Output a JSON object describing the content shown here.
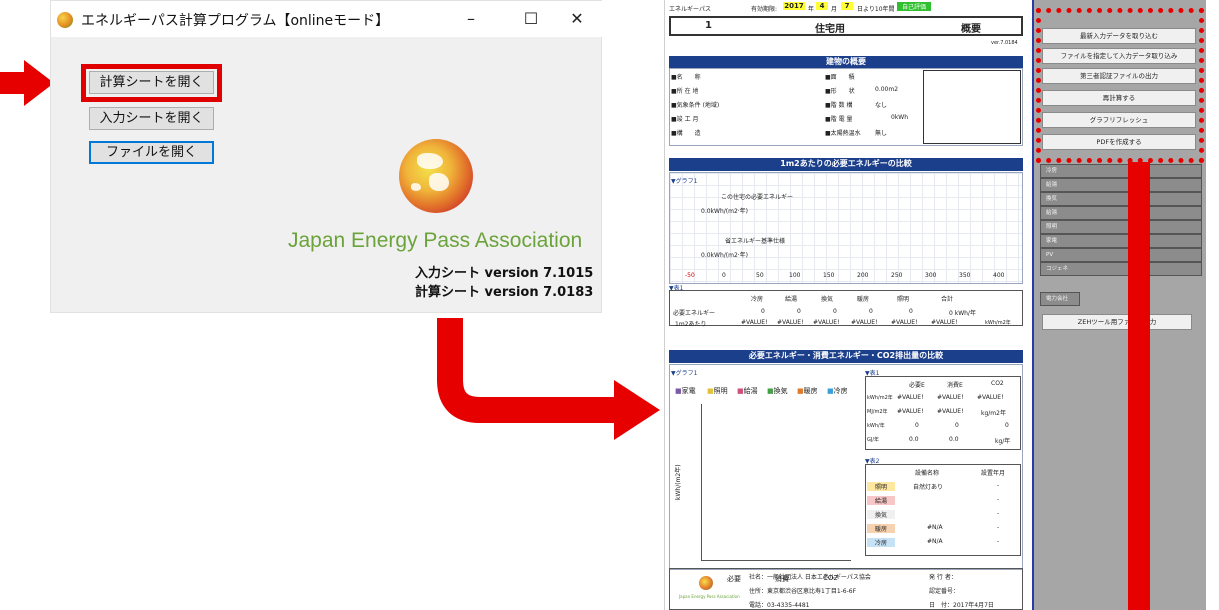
{
  "launcher": {
    "title": "エネルギーパス計算プログラム【onlineモード】",
    "minimize": "–",
    "maximize": "☐",
    "close": "✕",
    "buttons": {
      "open_calc": "計算シートを開く",
      "open_input": "入力シートを開く",
      "open_file": "ファイルを開く"
    },
    "org_name": "Japan Energy Pass Association",
    "input_version": "入力シート version 7.1015",
    "calc_version": "計算シート version 7.0183"
  },
  "sheet": {
    "header": {
      "app": "エネルギーパス",
      "valid_label": "有効期限:",
      "year": "2017",
      "year_unit": "年",
      "month": "4",
      "month_unit": "月",
      "day": "7",
      "period": "日より10年間",
      "self_eval": "自己評価",
      "number": "1",
      "type": "住宅用",
      "summary": "概要",
      "version": "ver.7.0184"
    },
    "overview": {
      "title": "建物の概要",
      "left_labels": [
        "■名　　称",
        "■所 在 地",
        "■気象条件 (地域)",
        "■竣 工 月",
        "■構　　造"
      ],
      "right_labels": [
        "■面　　積",
        "■形　　状",
        "■階 数 構",
        "■階 電 量",
        "■太陽熱温水"
      ],
      "right_values": [
        "",
        "0.00m2",
        "なし",
        "0kWh",
        "無し"
      ]
    },
    "compare": {
      "title": "1m2あたりの必要エネルギーの比較",
      "graph_label": "▼グラフ1",
      "this_house": "この住宅の必要エネルギー",
      "this_val": "0.0kWh/(m2·年)",
      "standard": "省エネルギー基準仕様",
      "standard_val": "0.0kWh/(m2·年)",
      "axis": [
        "-50",
        "0",
        "50",
        "100",
        "150",
        "200",
        "250",
        "300",
        "350",
        "400"
      ],
      "table_label": "▼表1",
      "columns": [
        "冷房",
        "給湯",
        "換気",
        "暖房",
        "照明",
        "合計"
      ],
      "row1_label": "必要エネルギー",
      "row1": [
        "0",
        "0",
        "0",
        "0",
        "0",
        "0 kWh/年"
      ],
      "row2_label": "1m2あたり",
      "row2": [
        "#VALUE!",
        "#VALUE!",
        "#VALUE!",
        "#VALUE!",
        "#VALUE!",
        "#VALUE!"
      ],
      "row2_unit": "kWh/m2年"
    },
    "co2": {
      "title": "必要エネルギー・消費エネルギー・CO2排出量の比較",
      "graph_label": "▼グラフ1",
      "legend": [
        "家電",
        "照明",
        "給湯",
        "換気",
        "暖房",
        "冷房"
      ],
      "y_axis": "kWh/(m2年)",
      "x_labels": [
        "必要",
        "消費",
        "CO2"
      ],
      "table_label": "▼表1",
      "cols": [
        "必要E",
        "消費E",
        "CO2"
      ],
      "rows": [
        {
          "unit": "kWh/m2年",
          "vals": [
            "#VALUE!",
            "#VALUE!",
            "#VALUE!"
          ]
        },
        {
          "unit": "MJ/m2年",
          "vals": [
            "#VALUE!",
            "#VALUE!",
            "kg/m2年"
          ]
        },
        {
          "unit": "kWh/年",
          "vals": [
            "0",
            "0",
            "0"
          ]
        },
        {
          "unit": "GJ/年",
          "vals": [
            "0.0",
            "0.0",
            "kg/年"
          ]
        }
      ],
      "equip_label": "▼表2",
      "equip_cols": [
        "設備名称",
        "設置年月"
      ],
      "equip_rows": [
        {
          "name": "照明",
          "val": "自然灯あり",
          "date": "-"
        },
        {
          "name": "給湯",
          "val": "",
          "date": "-"
        },
        {
          "name": "換気",
          "val": "",
          "date": "-"
        },
        {
          "name": "暖房",
          "val": "#N/A",
          "date": "-"
        },
        {
          "name": "冷房",
          "val": "#N/A",
          "date": "-"
        }
      ]
    },
    "footer": {
      "company": "社名：一般社団法人 日本エネルギーパス協会",
      "address": "住所：東京都渋谷区恵比寿1丁目1-6-6F",
      "tel": "電話：03-4335-4481",
      "issuer": "発 行 者：",
      "cert": "認定番号：",
      "date": "日　付：2017年4月7日",
      "logo_text": "Japan Energy Pass Association"
    }
  },
  "panel": {
    "buttons": [
      "最新入力データを取り込む",
      "ファイルを指定して入力データ取り込み",
      "第三者認証ファイルの出力",
      "再計算する",
      "グラフリフレッシュ",
      "PDFを作成する"
    ],
    "rows": [
      "冷房",
      "給湯",
      "換気",
      "給湯",
      "照明",
      "家電",
      "PV",
      "コジェネ"
    ],
    "power_label": "電力会社",
    "zeh_button": "ZEHツール用ファイル出力"
  },
  "colors": {
    "arrow": "#e60000",
    "header_blue": "#1c3f8c",
    "panel_gray": "#a6a6a6",
    "accent_green": "#6aa33a"
  }
}
